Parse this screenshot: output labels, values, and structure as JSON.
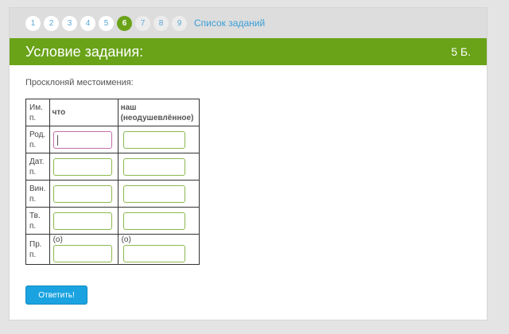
{
  "pager": {
    "pages": [
      "1",
      "2",
      "3",
      "4",
      "5",
      "6",
      "7",
      "8",
      "9"
    ],
    "current": "6",
    "task_list_link": "Список заданий"
  },
  "header": {
    "title": "Условие задания:",
    "points": "5 Б."
  },
  "task": {
    "instruction": "Просклоняй местоимения:"
  },
  "table": {
    "row_header_label": "Им. п.",
    "columns": [
      "что",
      "наш (неодушевлённое)"
    ],
    "rows": [
      {
        "label": "Род. п.",
        "prefix": ""
      },
      {
        "label": "Дат. п.",
        "prefix": ""
      },
      {
        "label": "Вин. п.",
        "prefix": ""
      },
      {
        "label": "Тв. п.",
        "prefix": ""
      },
      {
        "label": "Пр. п.",
        "prefix": "(о)"
      }
    ]
  },
  "submit_label": "Ответить!",
  "colors": {
    "accent_green": "#6aa318",
    "button_blue": "#1aa3e0",
    "link_blue": "#3b9ed8",
    "input_border": "#8cb84e",
    "input_focus_border": "#c26ea9"
  }
}
